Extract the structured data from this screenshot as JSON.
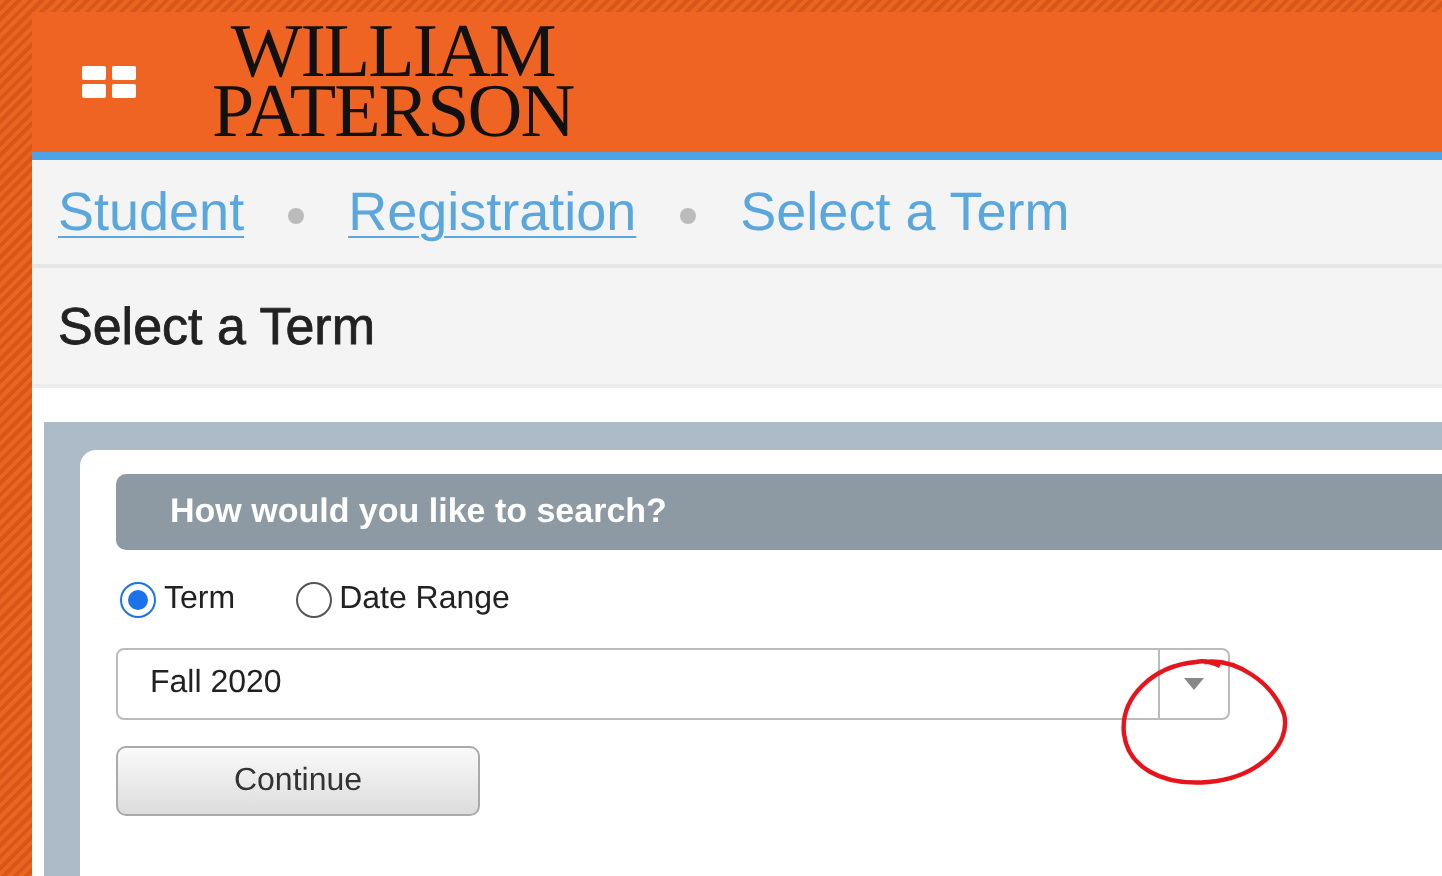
{
  "header": {
    "logo_lines": [
      "WILLIAM",
      "PATERSON"
    ]
  },
  "breadcrumbs": [
    {
      "label": "Student",
      "kind": "link"
    },
    {
      "label": "Registration",
      "kind": "link"
    },
    {
      "label": "Select a Term",
      "kind": "current"
    }
  ],
  "page_title": "Select a Term",
  "search": {
    "heading": "How would you like to search?",
    "options": [
      {
        "label": "Term",
        "selected": true
      },
      {
        "label": "Date Range",
        "selected": false
      }
    ],
    "term_select": {
      "value": "Fall 2020"
    },
    "button": "Continue"
  }
}
